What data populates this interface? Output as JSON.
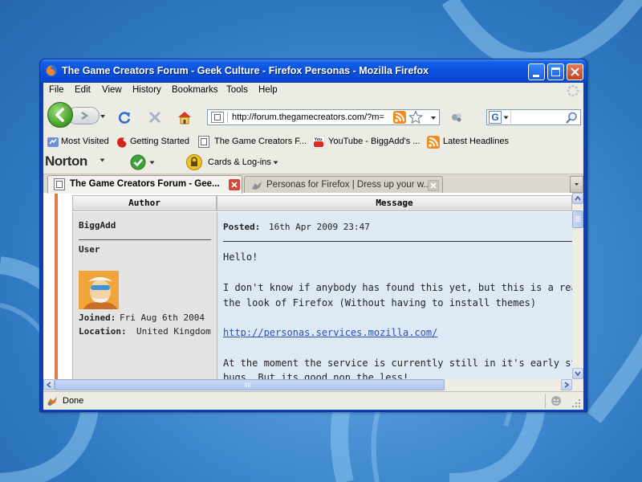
{
  "window": {
    "title": "The Game Creators Forum - Geek Culture -  Firefox Personas - Mozilla Firefox"
  },
  "menu": [
    "File",
    "Edit",
    "View",
    "History",
    "Bookmarks",
    "Tools",
    "Help"
  ],
  "nav": {
    "url": "http://forum.thegamecreators.com/?m=",
    "search_engine": "G"
  },
  "bookmarks": [
    {
      "label": "Most Visited",
      "icon": "most-visited-icon"
    },
    {
      "label": "Getting Started",
      "icon": "firefox-red-icon"
    },
    {
      "label": "The Game Creators F...",
      "icon": "page-icon"
    },
    {
      "label": "YouTube - BiggAdd's ...",
      "icon": "youtube-icon"
    },
    {
      "label": "Latest Headlines",
      "icon": "rss-icon"
    }
  ],
  "norton": {
    "logo": "Norton",
    "cards_label": "Cards & Log-ins"
  },
  "tabs": [
    {
      "label": "The Game Creators Forum - Gee...",
      "active": true
    },
    {
      "label": "Personas for Firefox | Dress up your w...",
      "active": false
    }
  ],
  "forum": {
    "author_header": "Author",
    "message_header": "Message",
    "author": {
      "name": "BiggAdd",
      "role": "User",
      "joined_label": "Joined:",
      "joined_value": "Fri Aug 6th 2004",
      "location_label": "Location:",
      "location_value": "United Kingdom"
    },
    "post": {
      "posted_label": "Posted:",
      "posted_value": "16th Apr 2009 23:47",
      "line1": "Hello!",
      "line2": "I don't know if anybody has found this yet, but this is a really nice wa",
      "line3": "the look of Firefox (Without having to install themes)",
      "link": "http://personas.services.mozilla.com/",
      "line4": "At the moment the service is currently still in it's early stages, so ther",
      "line5": "bugs. But its good non the less!"
    }
  },
  "status": {
    "text": "Done"
  },
  "colors": {
    "title_blue": "#0a50dc",
    "accent_orange": "#e07a48",
    "message_bg": "#dde9f5"
  }
}
